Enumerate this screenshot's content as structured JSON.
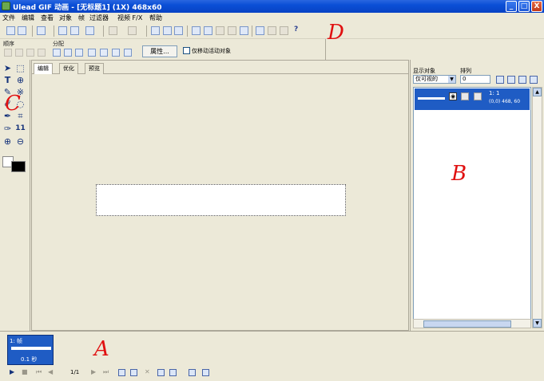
{
  "window": {
    "title": "Ulead GIF 动画 - [无标题1] (1X) 468x60",
    "minimize": "_",
    "maximize": "□",
    "close": "X"
  },
  "menu": [
    "文件",
    "编辑",
    "查看",
    "对象",
    "帧",
    "过滤器",
    "视频 F/X",
    "帮助"
  ],
  "toolbar2": {
    "label_order": "顺序",
    "label_distribute": "分配",
    "properties_button": "属性...",
    "checkbox_label": "仅移动活动对象"
  },
  "tabs": [
    "编辑",
    "优化",
    "预览"
  ],
  "tools": {
    "text_tool": "T",
    "fill_tool": "11"
  },
  "right_panel": {
    "label_display": "显示对象",
    "label_order": "排列",
    "display_select": "仅可视的",
    "order_value": "0",
    "layer": {
      "name": "1: 1",
      "info": "(0,0) 468, 60"
    }
  },
  "frames": {
    "frame1_num": "1: 帧",
    "frame1_delay": "0.1 秒",
    "counter": "1/1"
  },
  "annotations": {
    "a": "A",
    "b": "B",
    "c": "C",
    "d": "D"
  },
  "colors": {
    "title_bar": "#0842c4",
    "selection": "#1f5cc4",
    "annotation": "#e01010",
    "panel_bg": "#ece9d8"
  }
}
